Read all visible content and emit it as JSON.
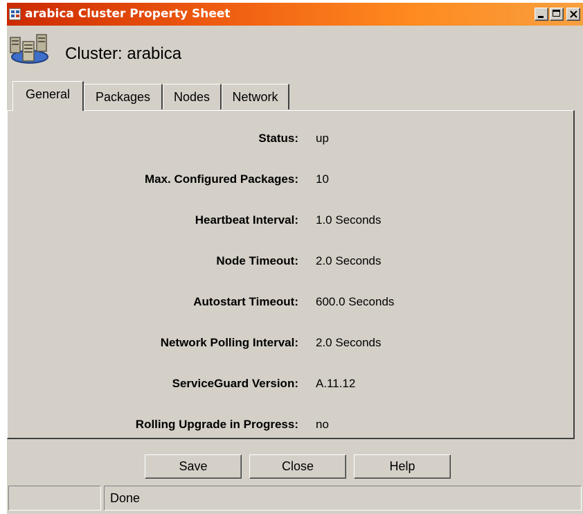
{
  "window": {
    "title": "arabica Cluster Property Sheet",
    "title_icon": "app-window-icon",
    "controls": {
      "minimize_icon": "minimize-icon",
      "maximize_icon": "maximize-icon",
      "close_icon": "close-icon"
    },
    "title_gradient": [
      "#cc2a00",
      "#ff8a20"
    ]
  },
  "header": {
    "icon": "cluster-servers-icon",
    "title": "Cluster: arabica"
  },
  "tabs": [
    {
      "label": "General",
      "active": true
    },
    {
      "label": "Packages",
      "active": false
    },
    {
      "label": "Nodes",
      "active": false
    },
    {
      "label": "Network",
      "active": false
    }
  ],
  "properties": [
    {
      "label": "Status:",
      "value": "up"
    },
    {
      "label": "Max. Configured Packages:",
      "value": "10"
    },
    {
      "label": "Heartbeat Interval:",
      "value": "1.0 Seconds"
    },
    {
      "label": "Node Timeout:",
      "value": "2.0 Seconds"
    },
    {
      "label": "Autostart Timeout:",
      "value": "600.0 Seconds"
    },
    {
      "label": "Network Polling Interval:",
      "value": "2.0 Seconds"
    },
    {
      "label": "ServiceGuard Version:",
      "value": "A.11.12"
    },
    {
      "label": "Rolling Upgrade in Progress:",
      "value": "no"
    }
  ],
  "buttons": {
    "save": "Save",
    "close": "Close",
    "help": "Help"
  },
  "statusbar": {
    "left": "",
    "message": "Done"
  },
  "colors": {
    "face": "#d4d0c8",
    "title_text": "#ffffff"
  }
}
